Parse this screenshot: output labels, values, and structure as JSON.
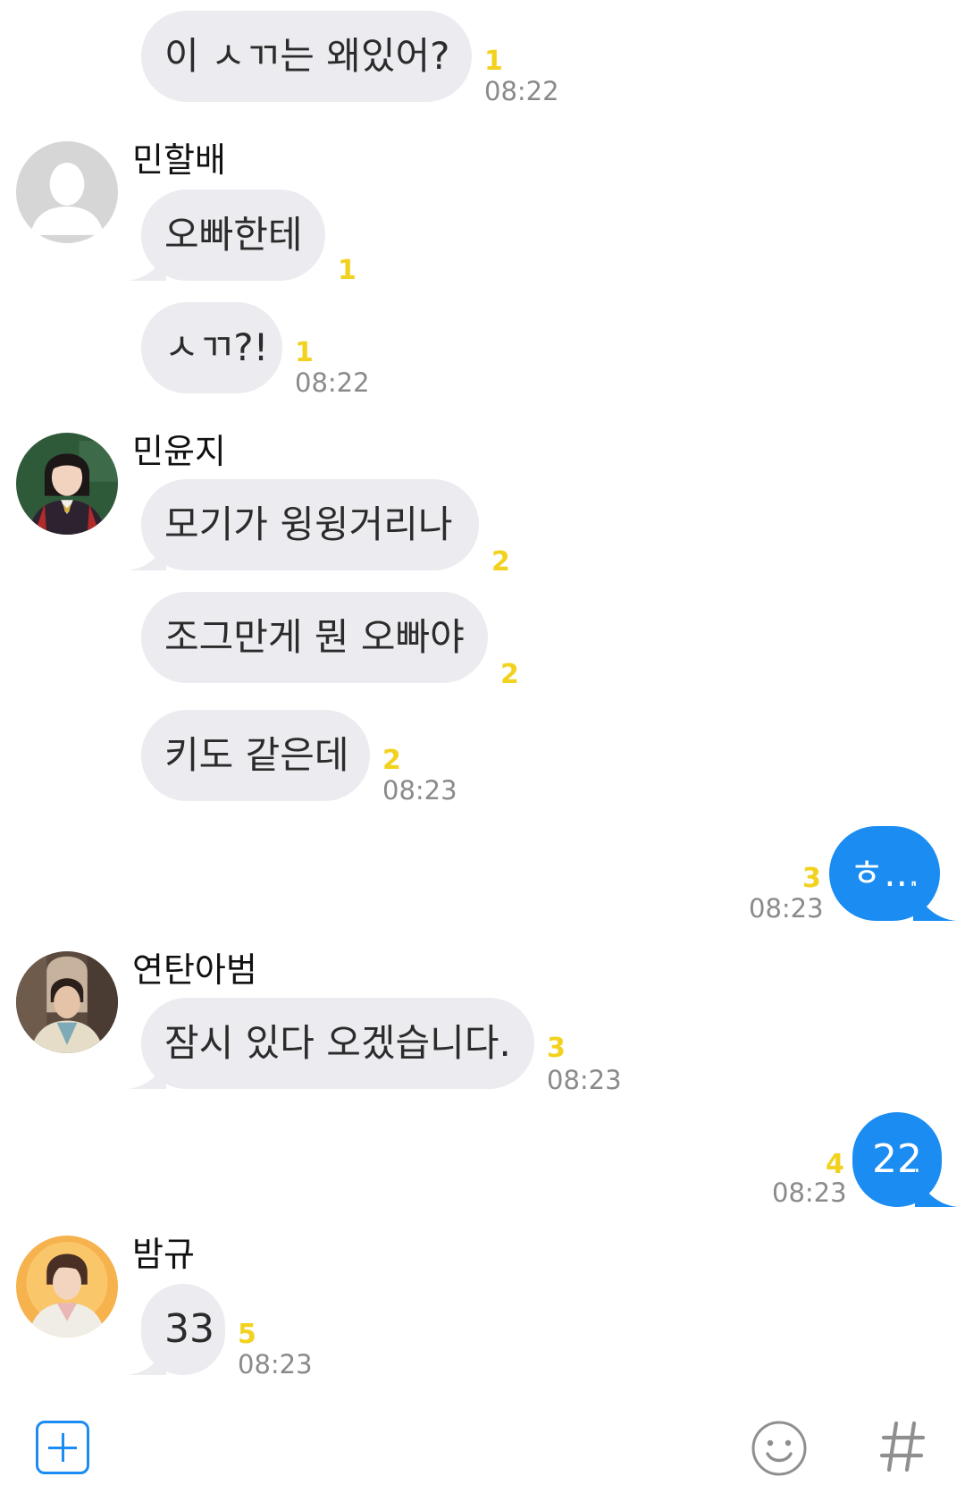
{
  "messages": [
    {
      "type": "in",
      "text": "이 ㅅㄲ는 왜있어?",
      "unread": "1",
      "time": "08:22"
    },
    {
      "type": "sender",
      "name": "민할배"
    },
    {
      "type": "in",
      "text": "오빠한테",
      "unread": "1"
    },
    {
      "type": "in",
      "text": "ㅅㄲ?!",
      "unread": "1",
      "time": "08:22"
    },
    {
      "type": "sender",
      "name": "민윤지"
    },
    {
      "type": "in",
      "text": "모기가 윙윙거리나",
      "unread": "2"
    },
    {
      "type": "in",
      "text": "조그만게 뭔 오빠야",
      "unread": "2"
    },
    {
      "type": "in",
      "text": "키도 같은데",
      "unread": "2",
      "time": "08:23"
    },
    {
      "type": "out",
      "text": "ㅎ...",
      "unread": "3",
      "time": "08:23"
    },
    {
      "type": "sender",
      "name": "연탄아범"
    },
    {
      "type": "in",
      "text": "잠시 있다 오겠습니다.",
      "unread": "3",
      "time": "08:23"
    },
    {
      "type": "out",
      "text": "22",
      "unread": "4",
      "time": "08:23"
    },
    {
      "type": "sender",
      "name": "밤규"
    },
    {
      "type": "in",
      "text": "33",
      "unread": "5",
      "time": "08:23"
    }
  ],
  "toolbar": {
    "left_icon": "plus-square-icon",
    "right_icons": [
      "emoji-icon",
      "hashtag-icon"
    ],
    "accent": "#1a8cf2"
  },
  "colors": {
    "incoming_bubble": "#ebebf0",
    "outgoing_bubble": "#1a8cf2",
    "unread_count": "#f2d21f",
    "timestamp": "#8a8a8a"
  }
}
